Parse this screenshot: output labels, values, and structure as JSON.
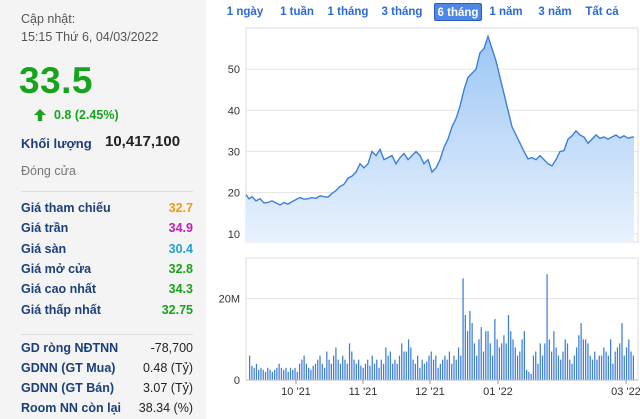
{
  "update": {
    "label": "Cập nhật:",
    "datetime": "15:15 Thứ 6, 04/03/2022"
  },
  "price": "33.5",
  "change": "0.8 (2.45%)",
  "volume": {
    "label": "Khối lượng",
    "value": "10,417,100"
  },
  "session_status": "Đóng cửa",
  "stats": [
    {
      "label": "Giá tham chiếu",
      "value": "32.7",
      "color": "#f39a0e"
    },
    {
      "label": "Giá trần",
      "value": "34.9",
      "color": "#c020b8"
    },
    {
      "label": "Giá sàn",
      "value": "30.4",
      "color": "#1f9fd6"
    },
    {
      "label": "Giá mở cửa",
      "value": "32.8",
      "color": "#17a31b"
    },
    {
      "label": "Giá cao nhất",
      "value": "34.3",
      "color": "#17a31b"
    },
    {
      "label": "Giá thấp nhất",
      "value": "32.75",
      "color": "#17a31b"
    }
  ],
  "foreign": [
    {
      "label": "GD ròng NĐTNN",
      "value": "-78,700"
    },
    {
      "label": "GDNN (GT Mua)",
      "value": "0.48 (Tỷ)"
    },
    {
      "label": "GDNN (GT Bán)",
      "value": "3.07 (Tỷ)"
    },
    {
      "label": "Room NN còn lại",
      "value": "38.34 (%)"
    }
  ],
  "colors": {
    "up": "#17a31b",
    "label": "#1a3f7a",
    "accent": "#4f86e8"
  },
  "tabs": [
    {
      "label": "1 ngày",
      "active": false
    },
    {
      "label": "1 tuần",
      "active": false
    },
    {
      "label": "1 tháng",
      "active": false
    },
    {
      "label": "3 tháng",
      "active": false
    },
    {
      "label": "6 tháng",
      "active": true
    },
    {
      "label": "1 năm",
      "active": false
    },
    {
      "label": "3 năm",
      "active": false
    },
    {
      "label": "Tất cả",
      "active": false
    }
  ],
  "chart_data": [
    {
      "type": "area",
      "ylim": [
        8,
        60
      ],
      "yticks": [
        10,
        20,
        30,
        40,
        50
      ],
      "x": [
        0,
        3,
        6,
        10,
        14,
        18,
        22,
        26,
        30,
        34,
        38,
        42,
        46,
        50,
        54,
        58,
        62,
        66,
        70,
        74,
        78,
        82,
        86,
        90,
        94,
        98,
        102,
        106,
        110,
        114,
        118,
        122,
        126,
        130,
        134,
        138,
        142,
        146,
        150,
        154,
        158,
        162,
        166,
        170,
        174,
        178,
        182,
        186,
        190,
        194,
        198,
        202,
        206,
        210,
        214,
        218,
        222,
        226,
        230,
        234,
        238,
        242,
        246,
        250,
        254,
        258,
        262,
        266,
        270,
        274,
        278,
        282,
        286,
        290,
        294,
        298,
        302,
        306,
        310,
        314,
        318,
        322,
        326,
        330,
        334,
        338,
        342,
        346,
        350,
        354,
        358,
        362,
        366,
        370,
        374,
        378,
        382,
        386,
        388
      ],
      "values": [
        19.5,
        18.5,
        19,
        18,
        18.5,
        17.5,
        17.6,
        18,
        17.5,
        17,
        17.6,
        17.2,
        17.8,
        18.3,
        18.8,
        18.4,
        18.5,
        18.8,
        18.6,
        19.2,
        19,
        18.9,
        19.8,
        20.5,
        21.5,
        22,
        23.5,
        24,
        25,
        27,
        26,
        27,
        30,
        29,
        30.5,
        28,
        28.5,
        29,
        27,
        28.5,
        29.5,
        28,
        29,
        30,
        29,
        27,
        28,
        25,
        26,
        28,
        31,
        33,
        36,
        38,
        41,
        45,
        48,
        49,
        50,
        54,
        55,
        58,
        55,
        52,
        48,
        44,
        40,
        36,
        34,
        32,
        30,
        28.2,
        28.5,
        28,
        29,
        28,
        27,
        26.5,
        28,
        30,
        30.2,
        33,
        33.8,
        35,
        34,
        33.5,
        32,
        33,
        34,
        33.2,
        33.5,
        33,
        33.5,
        34,
        33.3,
        33.8,
        33.2,
        33.5,
        33.5
      ]
    },
    {
      "type": "bar",
      "ylim": [
        0,
        30
      ],
      "yticks": [
        0,
        20
      ],
      "ytick_labels": [
        "0",
        "20M"
      ],
      "x_tick_labels": [
        "10 '21",
        "11 '21",
        "12 '21",
        "01 '22",
        "03 '22"
      ],
      "x_ticks": [
        50,
        117,
        184,
        252,
        380
      ],
      "values": [
        6,
        3.5,
        3,
        4,
        2.5,
        3,
        2.5,
        2,
        3,
        2.5,
        2,
        2.5,
        3,
        4,
        3,
        2.5,
        3,
        2,
        3,
        2.5,
        3,
        2,
        4,
        5,
        6,
        4,
        3,
        2.5,
        3.5,
        4,
        5,
        6,
        4,
        3,
        7,
        5,
        4,
        6,
        8,
        5,
        4,
        6,
        5,
        4,
        9,
        7,
        5,
        4,
        5,
        3.5,
        3,
        4,
        5,
        3.5,
        6,
        4,
        5,
        3,
        5,
        4,
        8,
        6,
        7,
        4,
        5,
        4,
        6,
        9,
        7,
        7,
        10,
        8,
        5,
        4,
        6,
        3,
        5,
        4,
        4.5,
        6,
        7,
        5,
        6,
        3,
        4,
        5,
        6,
        5,
        7,
        4,
        6,
        5,
        8,
        6,
        25,
        16,
        12,
        17,
        14,
        9,
        6,
        10,
        13,
        7,
        12,
        12,
        9,
        6,
        15,
        10,
        8,
        9,
        11,
        9,
        16,
        12,
        10,
        8,
        6,
        7,
        10,
        12,
        2.5,
        2,
        1.5,
        6,
        7,
        4,
        9,
        6,
        9,
        26,
        10,
        7,
        12,
        8,
        6,
        5,
        7,
        10,
        9,
        5,
        4,
        6,
        8,
        11,
        14,
        10,
        10,
        9,
        6,
        5,
        7,
        5,
        6,
        6,
        8,
        7,
        6,
        10,
        4,
        7,
        8,
        9,
        14,
        6,
        8,
        10,
        7,
        6
      ]
    }
  ]
}
